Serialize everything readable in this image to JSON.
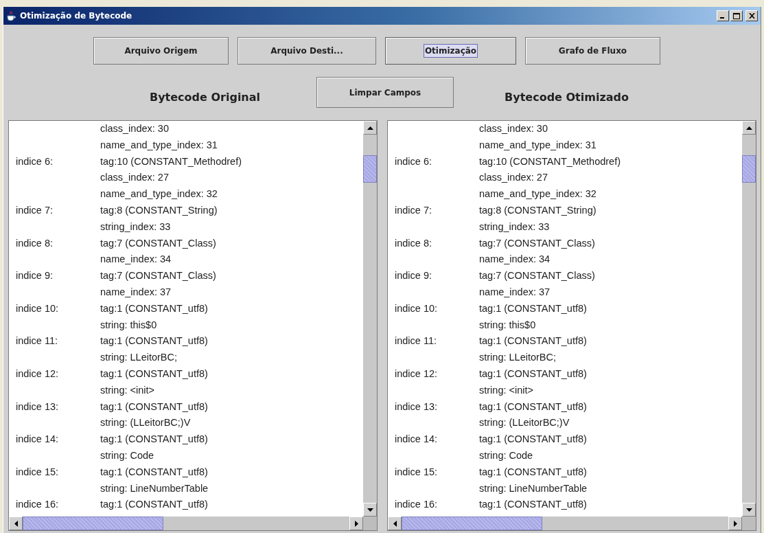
{
  "window": {
    "title": "Otimização de Bytecode"
  },
  "toolbar": [
    {
      "label": "Arquivo Origem",
      "focused": false
    },
    {
      "label": "Arquivo Desti...",
      "focused": false
    },
    {
      "label": "Otimização",
      "focused": true
    },
    {
      "label": "Grafo de Fluxo",
      "focused": false
    }
  ],
  "headings": {
    "original": "Bytecode Original",
    "optimized": "Bytecode Otimizado"
  },
  "clear_button": {
    "label": "Limpar Campos",
    "focused": false
  },
  "panels": [
    {
      "rows": [
        {
          "value": "class_index: 30"
        },
        {
          "value": "name_and_type_index: 31"
        },
        {
          "index": "indice 6:",
          "value": "tag:10 (CONSTANT_Methodref)"
        },
        {
          "value": "class_index: 27"
        },
        {
          "value": "name_and_type_index: 32"
        },
        {
          "index": "indice 7:",
          "value": "tag:8 (CONSTANT_String)"
        },
        {
          "value": "string_index: 33"
        },
        {
          "index": "indice 8:",
          "value": "tag:7 (CONSTANT_Class)"
        },
        {
          "value": "name_index: 34"
        },
        {
          "index": "indice 9:",
          "value": "tag:7 (CONSTANT_Class)"
        },
        {
          "value": "name_index: 37"
        },
        {
          "index": "indice 10:",
          "value": "tag:1 (CONSTANT_utf8)"
        },
        {
          "value": "string: this$0"
        },
        {
          "index": "indice 11:",
          "value": "tag:1 (CONSTANT_utf8)"
        },
        {
          "value": "string: LLeitorBC;"
        },
        {
          "index": "indice 12:",
          "value": "tag:1 (CONSTANT_utf8)"
        },
        {
          "value": "string: <init>"
        },
        {
          "index": "indice 13:",
          "value": "tag:1 (CONSTANT_utf8)"
        },
        {
          "value": "string: (LLeitorBC;)V"
        },
        {
          "index": "indice 14:",
          "value": "tag:1 (CONSTANT_utf8)"
        },
        {
          "value": "string: Code"
        },
        {
          "index": "indice 15:",
          "value": "tag:1 (CONSTANT_utf8)"
        },
        {
          "value": "string: LineNumberTable"
        },
        {
          "index": "indice 16:",
          "value": "tag:1 (CONSTANT_utf8)"
        }
      ]
    },
    {
      "rows": [
        {
          "value": "class_index: 30"
        },
        {
          "value": "name_and_type_index: 31"
        },
        {
          "index": "indice 6:",
          "value": "tag:10 (CONSTANT_Methodref)"
        },
        {
          "value": "class_index: 27"
        },
        {
          "value": "name_and_type_index: 32"
        },
        {
          "index": "indice 7:",
          "value": "tag:8 (CONSTANT_String)"
        },
        {
          "value": "string_index: 33"
        },
        {
          "index": "indice 8:",
          "value": "tag:7 (CONSTANT_Class)"
        },
        {
          "value": "name_index: 34"
        },
        {
          "index": "indice 9:",
          "value": "tag:7 (CONSTANT_Class)"
        },
        {
          "value": "name_index: 37"
        },
        {
          "index": "indice 10:",
          "value": "tag:1 (CONSTANT_utf8)"
        },
        {
          "value": "string: this$0"
        },
        {
          "index": "indice 11:",
          "value": "tag:1 (CONSTANT_utf8)"
        },
        {
          "value": "string: LLeitorBC;"
        },
        {
          "index": "indice 12:",
          "value": "tag:1 (CONSTANT_utf8)"
        },
        {
          "value": "string: <init>"
        },
        {
          "index": "indice 13:",
          "value": "tag:1 (CONSTANT_utf8)"
        },
        {
          "value": "string: (LLeitorBC;)V"
        },
        {
          "index": "indice 14:",
          "value": "tag:1 (CONSTANT_utf8)"
        },
        {
          "value": "string: Code"
        },
        {
          "index": "indice 15:",
          "value": "tag:1 (CONSTANT_utf8)"
        },
        {
          "value": "string: LineNumberTable"
        },
        {
          "index": "indice 16:",
          "value": "tag:1 (CONSTANT_utf8)"
        }
      ]
    }
  ]
}
